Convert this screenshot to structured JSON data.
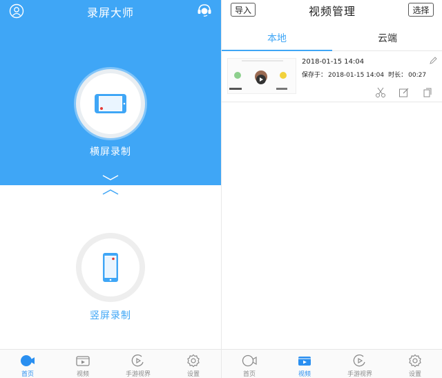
{
  "left": {
    "app_title": "录屏大师",
    "landscape_label": "横屏录制",
    "portrait_label": "竖屏录制",
    "tabs": [
      {
        "label": "首页",
        "icon": "camera-icon",
        "active": true
      },
      {
        "label": "视频",
        "icon": "video-icon",
        "active": false
      },
      {
        "label": "手游视界",
        "icon": "game-play-icon",
        "active": false
      },
      {
        "label": "设置",
        "icon": "gear-icon",
        "active": false
      }
    ]
  },
  "right": {
    "title": "视频管理",
    "import_label": "导入",
    "select_label": "选择",
    "segments": [
      {
        "label": "本地",
        "active": true
      },
      {
        "label": "云端",
        "active": false
      }
    ],
    "video": {
      "date": "2018-01-15 14:04",
      "saved_label": "保存于：",
      "saved_value": "2018-01-15 14:04",
      "duration_label": "时长：",
      "duration_value": "00:27"
    },
    "tabs": [
      {
        "label": "首页",
        "icon": "camera-icon",
        "active": false
      },
      {
        "label": "视频",
        "icon": "video-icon",
        "active": true
      },
      {
        "label": "手游视界",
        "icon": "game-play-icon",
        "active": false
      },
      {
        "label": "设置",
        "icon": "gear-icon",
        "active": false
      }
    ]
  },
  "colors": {
    "accent": "#3fa6f6",
    "tab_active": "#2a8ff0",
    "record_dot": "#e53935"
  }
}
